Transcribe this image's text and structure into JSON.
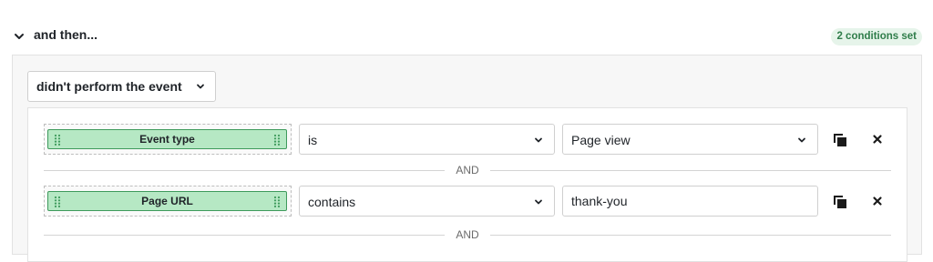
{
  "header": {
    "title": "and then...",
    "badge": "2 conditions set"
  },
  "mode_select": {
    "value": "didn't perform the event"
  },
  "conditions": [
    {
      "field": "Event type",
      "operator": "is",
      "value": "Page view",
      "value_kind": "select"
    },
    {
      "field": "Page URL",
      "operator": "contains",
      "value": "thank-you",
      "value_kind": "text"
    }
  ],
  "separators": [
    "AND",
    "AND"
  ],
  "icons": {
    "toggle": "chevron-down-icon",
    "copy": "copy-icon",
    "remove": "close-icon",
    "drag": "drag-handle-icon"
  },
  "colors": {
    "pill_fill": "#b6e8c4",
    "pill_border": "#3e9a5c",
    "badge_bg": "#e6f4ea",
    "badge_text": "#2f7d4a"
  }
}
